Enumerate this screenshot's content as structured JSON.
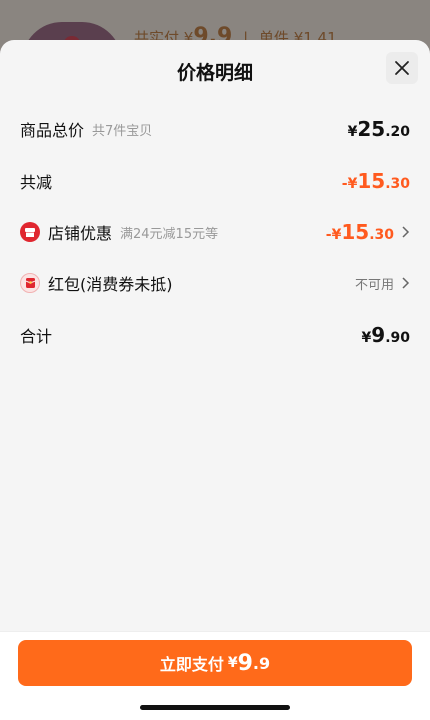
{
  "background": {
    "total_paid_label": "共实付 ¥",
    "total_paid_value": "9.9",
    "unit_price_label": "单件 ¥1.41"
  },
  "sheet": {
    "title": "价格明细",
    "rows": [
      {
        "label": "商品总价",
        "sub": "共7件宝贝",
        "yen": "¥",
        "int": "25",
        "dec": ".20"
      },
      {
        "label": "共减",
        "yen": "-¥",
        "int": "15",
        "dec": ".30"
      },
      {
        "label": "店铺优惠",
        "sub": "满24元减15元等",
        "yen": "-¥",
        "int": "15",
        "dec": ".30"
      },
      {
        "label": "红包(消费券未抵)",
        "value_text": "不可用"
      },
      {
        "label": "合计",
        "yen": "¥",
        "int": "9",
        "dec": ".90"
      }
    ]
  },
  "pay_button": {
    "label": "立即支付",
    "yen": "¥",
    "int": "9",
    "dec": ".9"
  },
  "colors": {
    "accent": "#ff6a1a",
    "discount": "#ff5a1f",
    "store_badge": "#e0262f"
  },
  "icons": {
    "close": "close-icon",
    "store": "store-icon",
    "redpack": "red-packet-icon",
    "chevron": "chevron-right-icon"
  }
}
